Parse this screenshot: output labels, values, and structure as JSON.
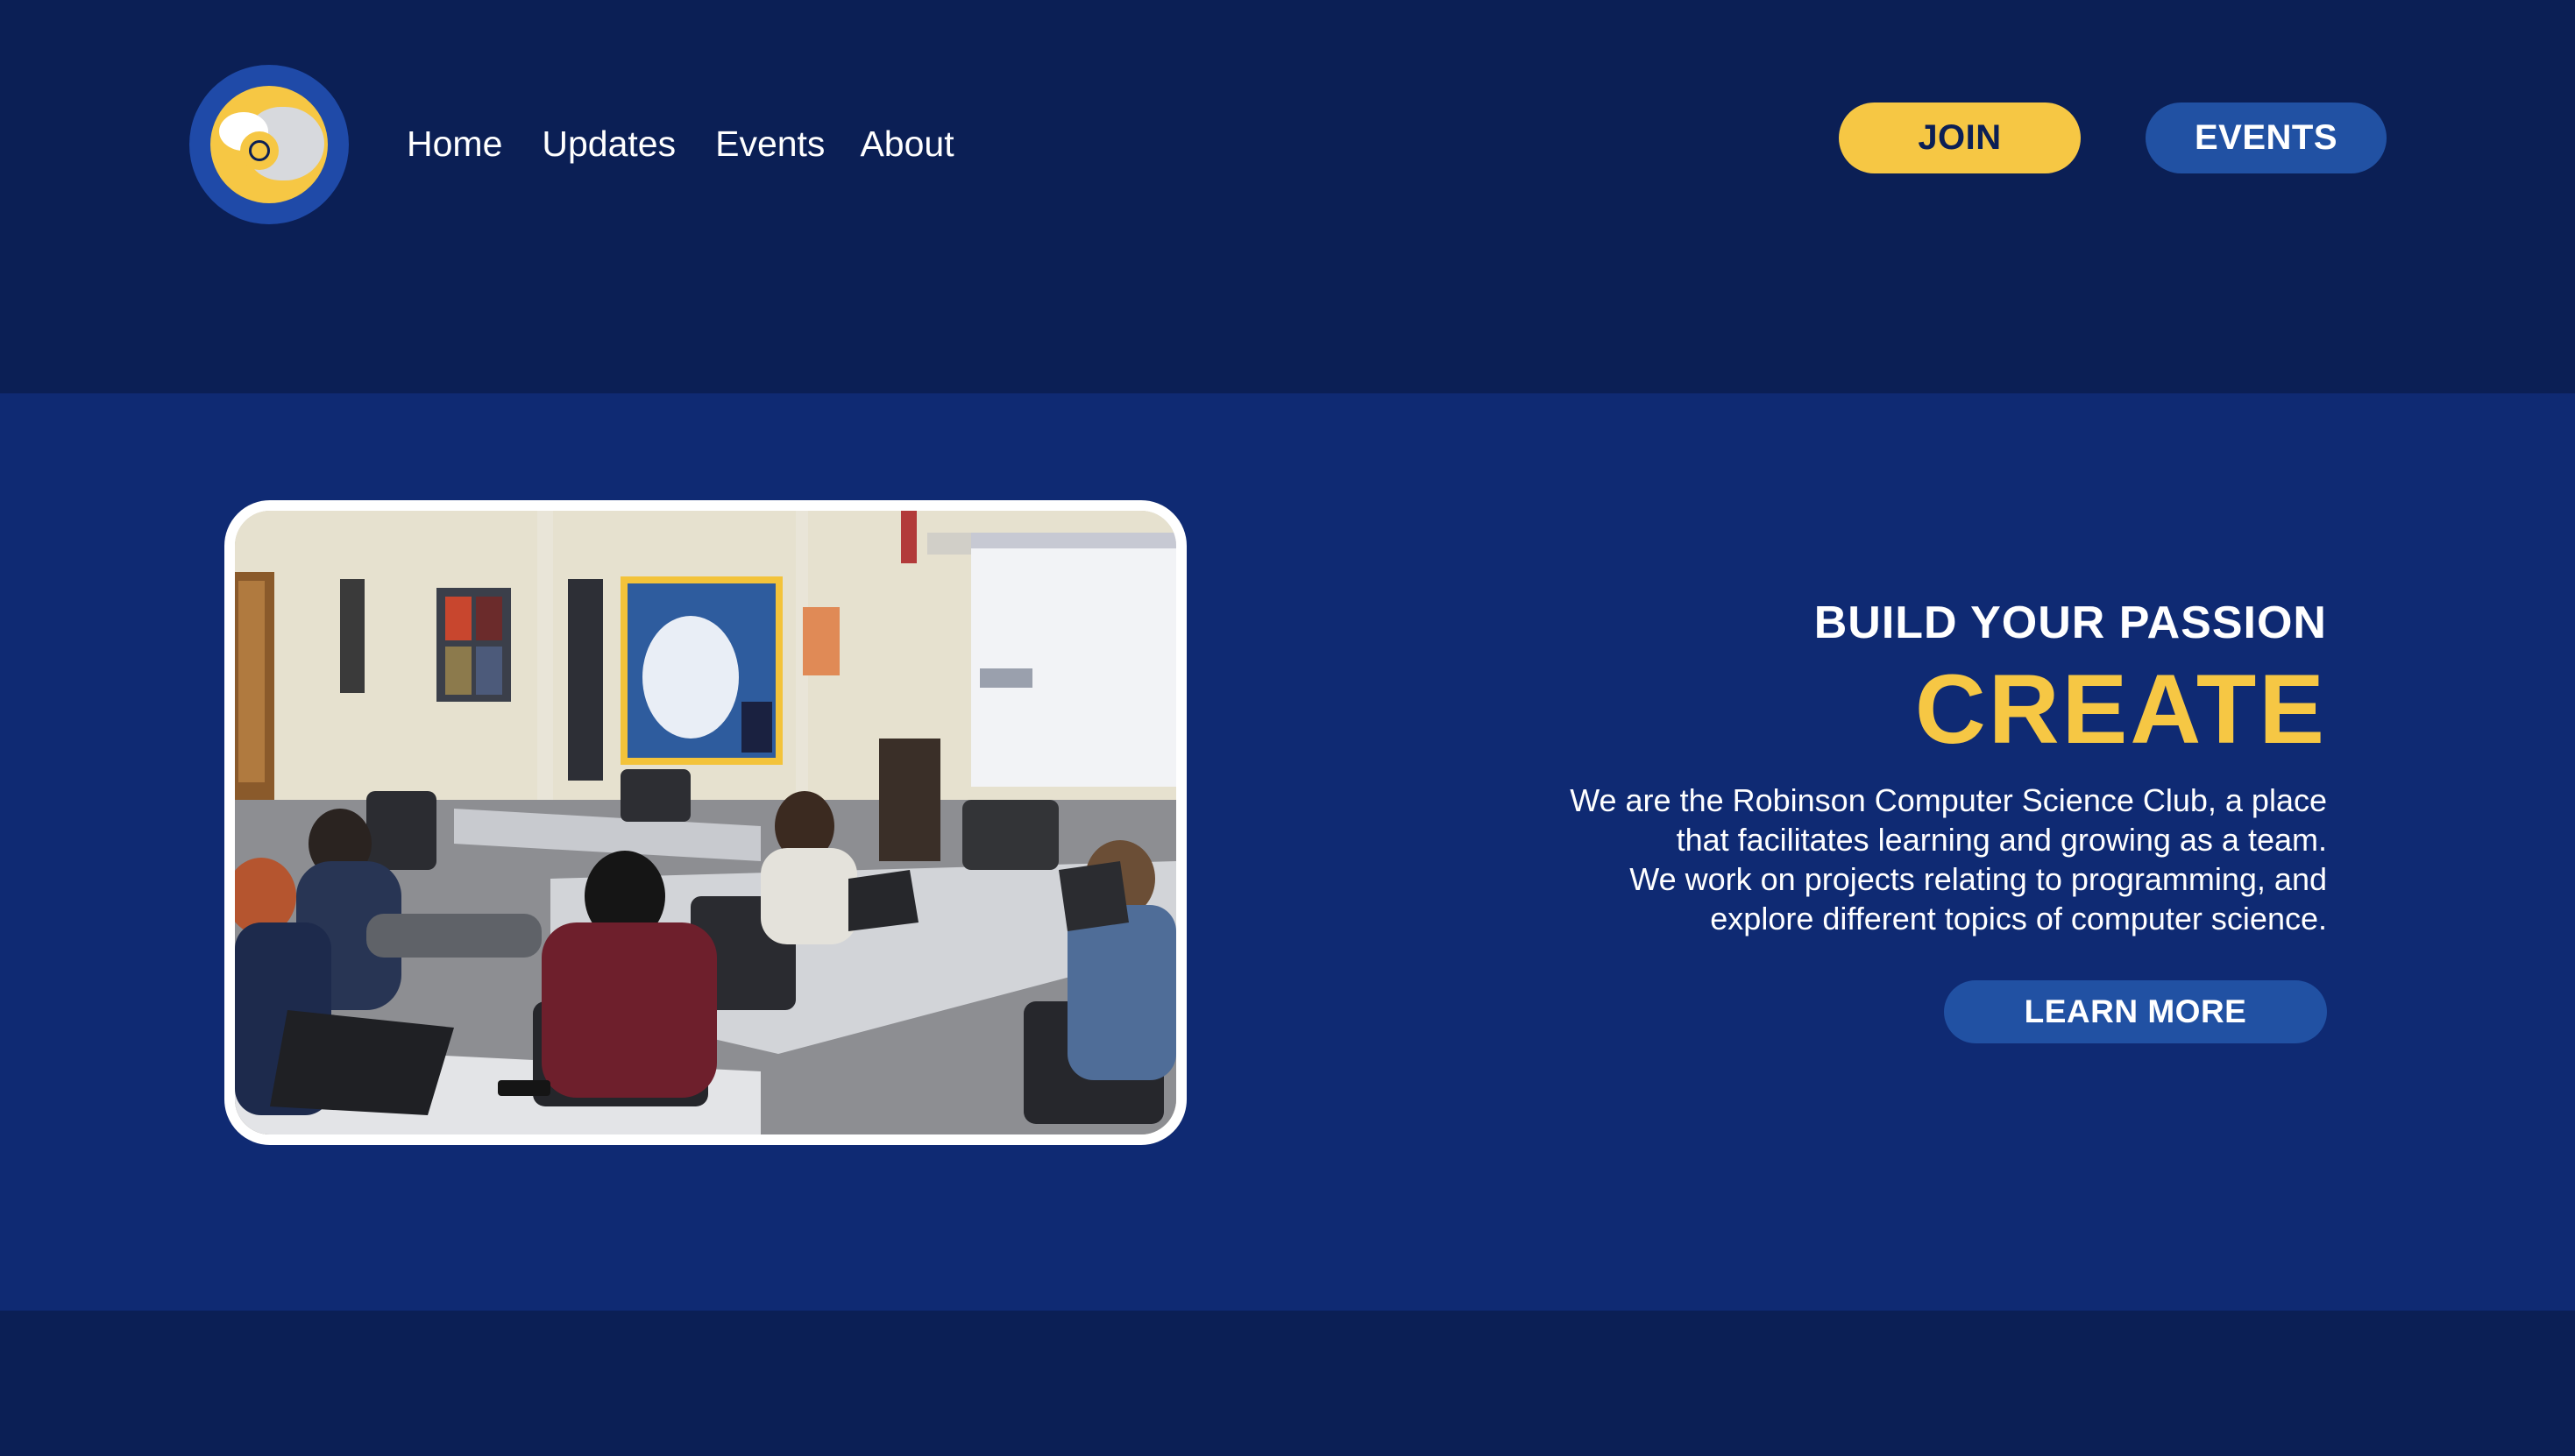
{
  "header": {
    "logo_icon": "ram-mascot-icon",
    "nav": [
      {
        "label": "Home"
      },
      {
        "label": "Updates"
      },
      {
        "label": "Events"
      },
      {
        "label": "About"
      }
    ],
    "join_label": "JOIN",
    "events_label": "EVENTS"
  },
  "hero": {
    "photo": "classroom-photo",
    "tagline": "BUILD YOUR PASSION",
    "headline": "CREATE",
    "description_lines": [
      "We are the Robinson Computer Science Club, a place",
      "that facilitates learning and growing as a team.",
      "We work on projects relating to programming, and",
      "explore different topics of computer science."
    ],
    "learn_more_label": "LEARN MORE"
  },
  "colors": {
    "header_bg": "#0b1f55",
    "hero_bg": "#0f2a73",
    "accent_yellow": "#f6c744",
    "button_blue": "#2151a3",
    "text_white": "#ffffff"
  }
}
